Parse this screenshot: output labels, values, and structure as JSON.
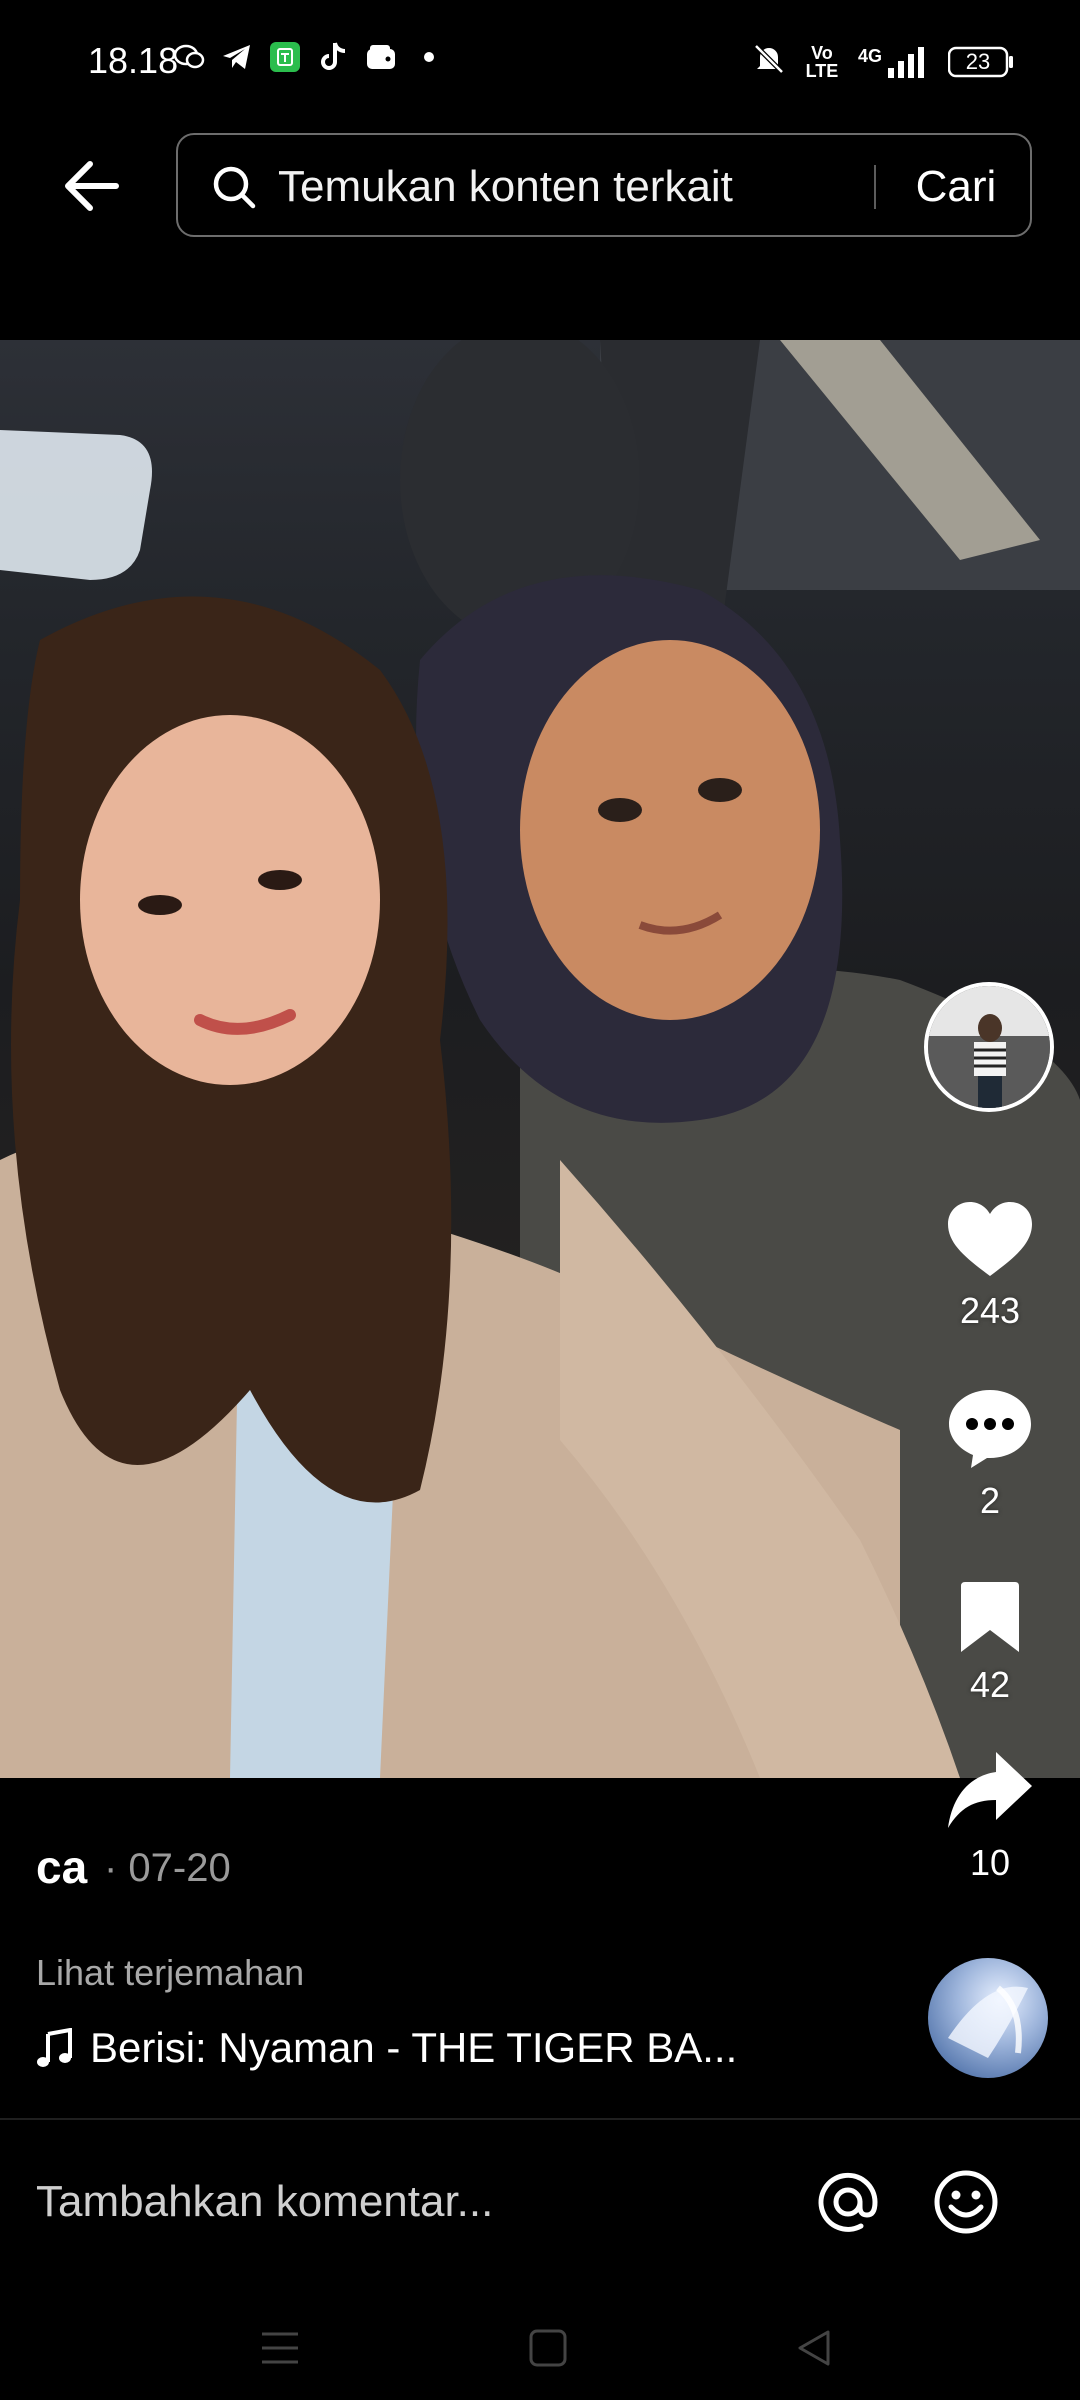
{
  "status_bar": {
    "time": "18.18",
    "network": "4G",
    "volte": "Vo LTE",
    "battery": "23"
  },
  "search": {
    "placeholder": "Temukan konten terkait",
    "button_label": "Cari"
  },
  "actions": {
    "likes": "243",
    "comments": "2",
    "bookmarks": "42",
    "shares": "10"
  },
  "post": {
    "author": "ca",
    "date": "· 07-20",
    "translate_label": "Lihat terjemahan",
    "music_label": "Berisi: Nyaman - THE TIGER BA..."
  },
  "comment_bar": {
    "placeholder": "Tambahkan komentar..."
  },
  "icons": [
    "back-arrow-icon",
    "search-icon",
    "heart-icon",
    "comment-icon",
    "bookmark-icon",
    "share-icon",
    "music-note-icon",
    "at-icon",
    "emoji-icon",
    "menu-icon",
    "home-icon",
    "back-icon"
  ]
}
